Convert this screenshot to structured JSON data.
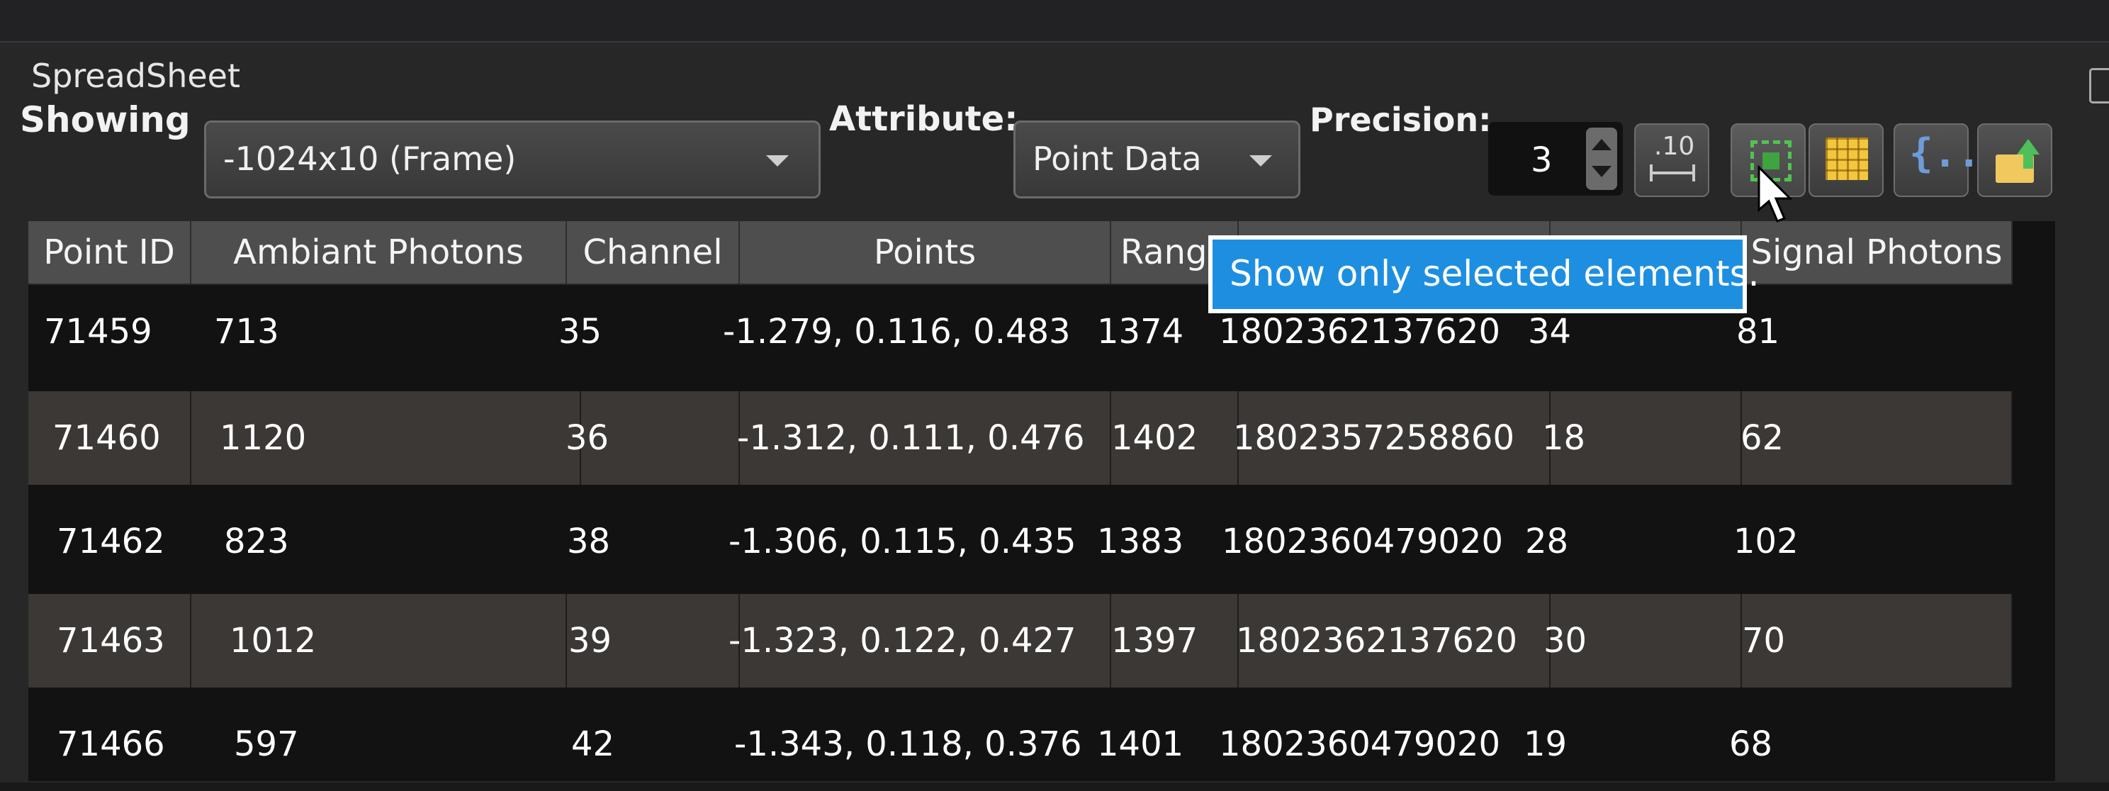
{
  "window": {
    "title": "SpreadSheet"
  },
  "toolbar": {
    "showing_label": "Showing",
    "showing_value": "-1024x10 (Frame)",
    "attribute_label": "Attribute:",
    "attribute_value": "Point Data",
    "precision_label": "Precision:",
    "precision_value": "3",
    "fixed_repr_glyph": ".10",
    "cell_connectivity_glyph": "{...}",
    "tooltip": "Show only selected elements."
  },
  "icons": [
    "fixed-representation-icon",
    "show-selected-icon",
    "toggle-column-visibility-icon",
    "cell-connectivity-icon",
    "export-icon",
    "mouse-cursor-icon"
  ],
  "colors": {
    "tooltip_bg": "#1e8fe0",
    "panel_bg": "#272727",
    "row_alt_bg": "#3b3836",
    "header_bg": "#4e4e4e"
  },
  "table": {
    "headers": [
      "Point ID",
      "Ambiant Photons",
      "Channel",
      "Points",
      "Range",
      "",
      "",
      "Signal Photons"
    ],
    "rows": [
      [
        "71459",
        "713",
        "35",
        "-1.279, 0.116, 0.483",
        "1374",
        "1802362137620",
        "34",
        "81"
      ],
      [
        "71460",
        "1120",
        "36",
        "-1.312, 0.111, 0.476",
        "1402",
        "1802357258860",
        "18",
        "62"
      ],
      [
        "71462",
        "823",
        "38",
        "-1.306, 0.115, 0.435",
        "1383",
        "1802360479020",
        "28",
        "102"
      ],
      [
        "71463",
        "1012",
        "39",
        "-1.323, 0.122, 0.427",
        "1397",
        "1802362137620",
        "30",
        "70"
      ],
      [
        "71466",
        "597",
        "42",
        "-1.343, 0.118, 0.376",
        "1401",
        "1802360479020",
        "19",
        "68"
      ]
    ]
  }
}
